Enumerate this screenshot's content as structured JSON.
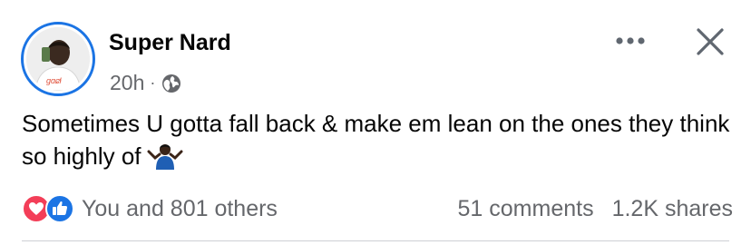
{
  "post": {
    "author": "Super Nard",
    "timestamp": "20h",
    "separator": "·",
    "audience_icon": "globe-icon",
    "text": "Sometimes U gotta fall back & make em lean on the ones they think so highly of",
    "emoji": "person-shrugging",
    "avatar_caption": "ॐꙍ"
  },
  "header_actions": {
    "more_icon": "more-options-icon",
    "close_icon": "close-icon"
  },
  "engagement": {
    "reaction_icons": [
      "love-reaction-icon",
      "like-reaction-icon"
    ],
    "reactions_label": "You and 801 others",
    "comments_label": "51 comments",
    "shares_label": "1.2K shares"
  },
  "colors": {
    "brand_blue": "#1b74e4",
    "love_red": "#f33e58",
    "secondary_text": "#65676b",
    "primary_text": "#050505"
  }
}
